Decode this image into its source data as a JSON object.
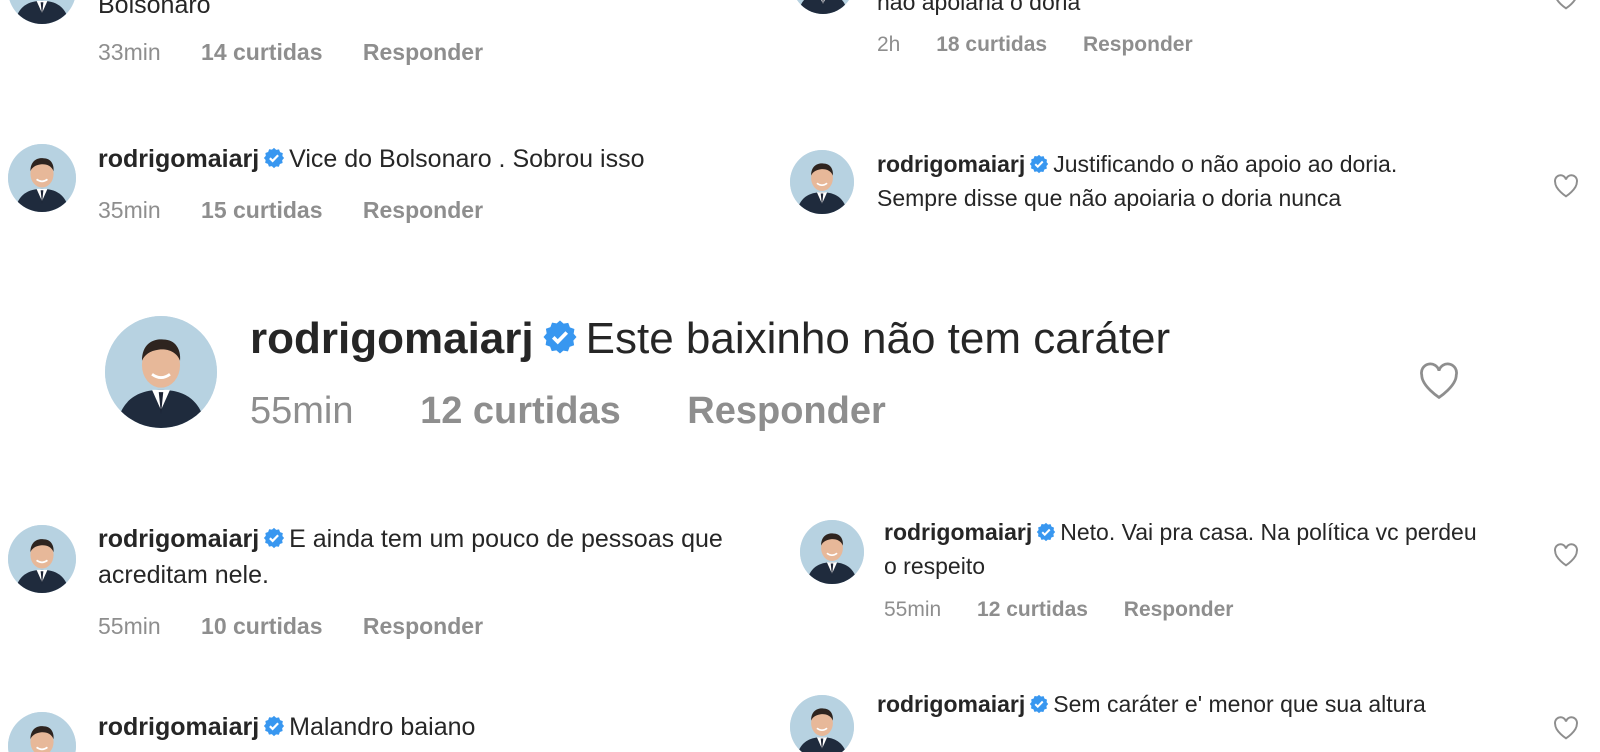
{
  "colors": {
    "verified": "#3897f0",
    "username": "#262626",
    "meta": "#8e8e8e"
  },
  "icons": {
    "verified": "verified-badge-icon",
    "like": "heart-icon"
  },
  "comments": [
    {
      "username": "rodrigomaiarj",
      "text": "Bolsonaro",
      "time": "33min",
      "likes": "14 curtidas",
      "reply": "Responder"
    },
    {
      "username": "rodrigomaiarj",
      "text": "não apoiaria o doria",
      "time": "2h",
      "likes": "18 curtidas",
      "reply": "Responder"
    },
    {
      "username": "rodrigomaiarj",
      "text": "Vice do Bolsonaro . Sobrou isso",
      "time": "35min",
      "likes": "15 curtidas",
      "reply": "Responder"
    },
    {
      "username": "rodrigomaiarj",
      "text": "Justificando o não apoio ao doria. Sempre disse que não apoiaria o doria nunca"
    },
    {
      "username": "rodrigomaiarj",
      "text": "Este baixinho não tem caráter",
      "time": "55min",
      "likes": "12 curtidas",
      "reply": "Responder"
    },
    {
      "username": "rodrigomaiarj",
      "text": "E ainda tem um pouco de pessoas que acreditam nele.",
      "time": "55min",
      "likes": "10 curtidas",
      "reply": "Responder"
    },
    {
      "username": "rodrigomaiarj",
      "text": "Neto. Vai pra casa. Na política vc perdeu o respeito",
      "time": "55min",
      "likes": "12 curtidas",
      "reply": "Responder"
    },
    {
      "username": "rodrigomaiarj",
      "text": "Malandro baiano"
    },
    {
      "username": "rodrigomaiarj",
      "text": "Sem caráter e' menor que sua altura"
    }
  ]
}
